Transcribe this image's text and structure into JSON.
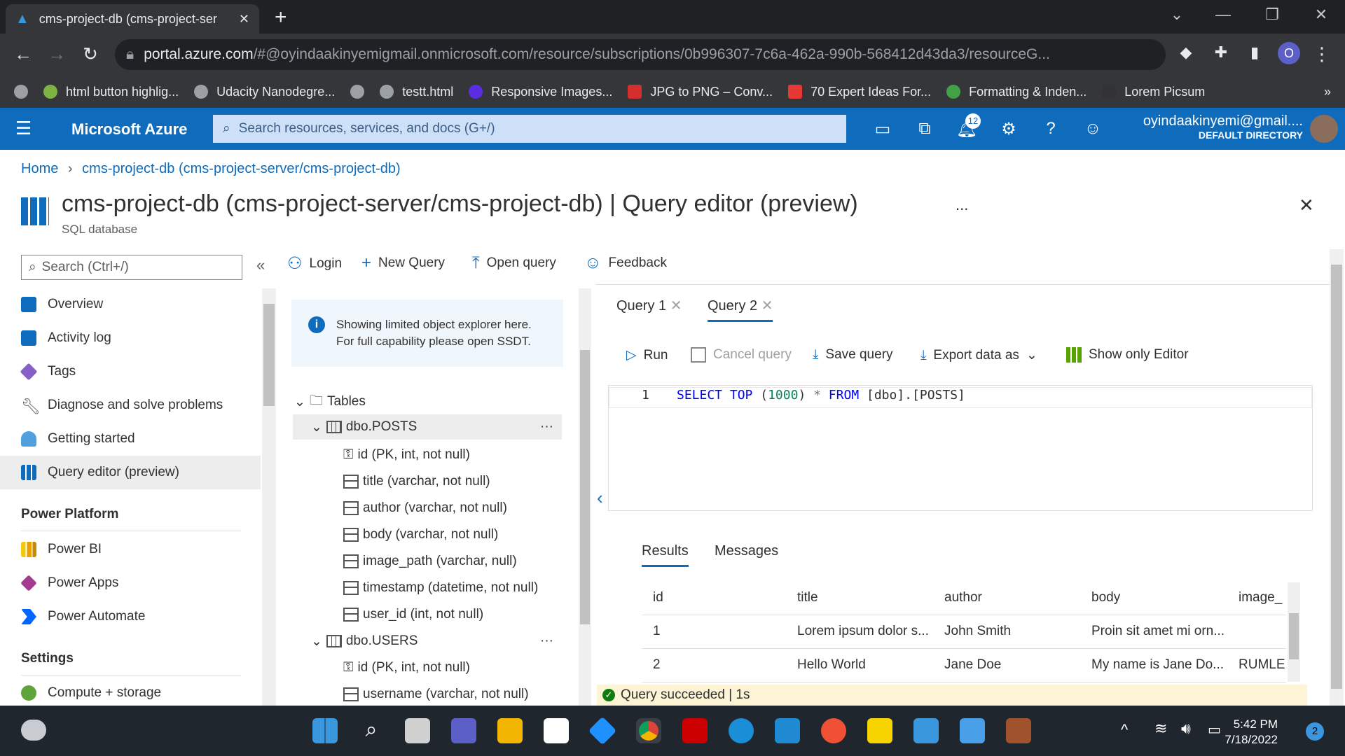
{
  "browser": {
    "tab_title": "cms-project-db (cms-project-ser",
    "url_domain": "portal.azure.com",
    "url_rest": "/#@oyindaakinyemigmail.onmicrosoft.com/resource/subscriptions/0b996307-7c6a-462a-990b-568412d43da3/resourceG...",
    "profile_initial": "O",
    "bookmarks": [
      "html button highlig...",
      "Udacity Nanodegre...",
      "",
      "testt.html",
      "Responsive Images...",
      "JPG to PNG – Conv...",
      "70 Expert Ideas For...",
      "Formatting & Inden...",
      "Lorem Picsum"
    ]
  },
  "azure": {
    "brand": "Microsoft Azure",
    "search_placeholder": "Search resources, services, and docs (G+/)",
    "notification_count": "12",
    "user_email": "oyindaakinyemi@gmail....",
    "user_directory": "DEFAULT DIRECTORY"
  },
  "breadcrumb": {
    "home": "Home",
    "current": "cms-project-db (cms-project-server/cms-project-db)"
  },
  "page": {
    "title": "cms-project-db (cms-project-server/cms-project-db) | Query editor (preview)",
    "subtitle": "SQL database",
    "more": "..."
  },
  "sidebar": {
    "search_placeholder": "Search (Ctrl+/)",
    "items": [
      {
        "label": "Overview",
        "color": "#0f6cbd"
      },
      {
        "label": "Activity log",
        "color": "#0f6cbd"
      },
      {
        "label": "Tags",
        "color": "#8661c5"
      },
      {
        "label": "Diagnose and solve problems",
        "color": "#605e5c"
      },
      {
        "label": "Getting started",
        "color": "#50a0e0"
      },
      {
        "label": "Query editor (preview)",
        "color": "#0f6cbd"
      }
    ],
    "power_platform_heading": "Power Platform",
    "power_items": [
      {
        "label": "Power BI",
        "color": "#f2c811"
      },
      {
        "label": "Power Apps",
        "color": "#a33b8f"
      },
      {
        "label": "Power Automate",
        "color": "#0066ff"
      }
    ],
    "settings_heading": "Settings",
    "settings_items": [
      {
        "label": "Compute + storage",
        "color": "#5ea43b"
      }
    ]
  },
  "toolbar": {
    "login": "Login",
    "new_query": "New Query",
    "open_query": "Open query",
    "feedback": "Feedback"
  },
  "explorer": {
    "info_line1": "Showing limited object explorer here.",
    "info_line2": "For full capability please open SSDT.",
    "tables_label": "Tables",
    "posts_table": "dbo.POSTS",
    "posts_columns": [
      "id (PK, int, not null)",
      "title (varchar, not null)",
      "author (varchar, not null)",
      "body (varchar, not null)",
      "image_path (varchar, null)",
      "timestamp (datetime, not null)",
      "user_id (int, not null)"
    ],
    "users_table": "dbo.USERS",
    "users_columns": [
      "id (PK, int, not null)",
      "username (varchar, not null)"
    ],
    "more": "···"
  },
  "query": {
    "tabs": [
      "Query 1",
      "Query 2"
    ],
    "run": "Run",
    "cancel": "Cancel query",
    "save": "Save query",
    "export": "Export data as",
    "show_editor": "Show only Editor",
    "line_number": "1",
    "sql": {
      "select": "SELECT",
      "top": "TOP",
      "open": " (",
      "num": "1000",
      "close": ") ",
      "star": "*",
      "from": " FROM",
      "rest": " [dbo].[POSTS]"
    }
  },
  "results": {
    "tabs": [
      "Results",
      "Messages"
    ],
    "columns": [
      "id",
      "title",
      "author",
      "body",
      "image_"
    ],
    "rows": [
      [
        "1",
        "Lorem ipsum dolor s...",
        "John Smith",
        "Proin sit amet mi orn...",
        ""
      ],
      [
        "2",
        "Hello World",
        "Jane Doe",
        "My name is Jane Do...",
        "RUMLE"
      ]
    ],
    "status": "Query succeeded | 1s"
  },
  "taskbar": {
    "time": "5:42 PM",
    "date": "7/18/2022",
    "notif": "2"
  }
}
